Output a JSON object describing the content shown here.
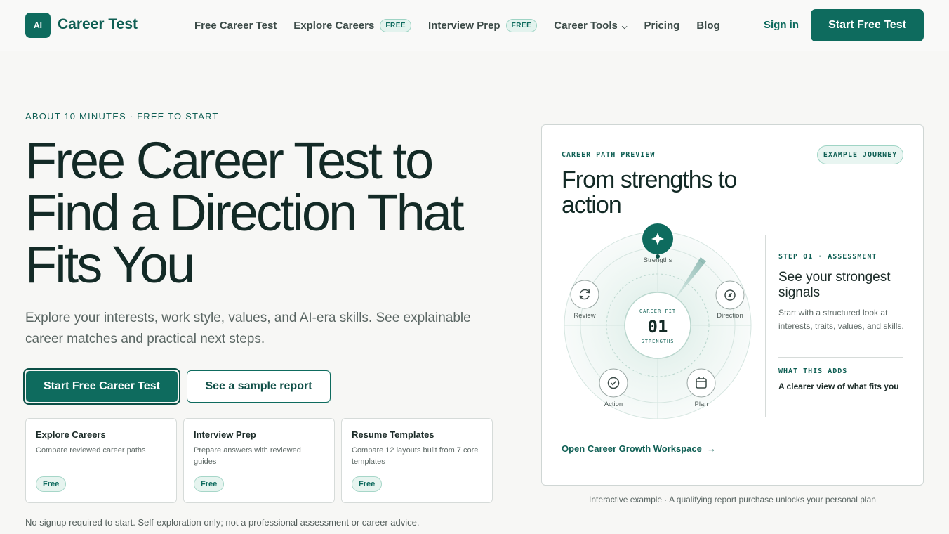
{
  "header": {
    "logo_badge": "AI",
    "logo_text": "Career Test",
    "nav": [
      {
        "label": "Free Career Test"
      },
      {
        "label": "Explore Careers",
        "badge": "FREE"
      },
      {
        "label": "Interview Prep",
        "badge": "FREE"
      },
      {
        "label": "Career Tools"
      },
      {
        "label": "Pricing"
      },
      {
        "label": "Blog"
      }
    ],
    "sign_in": "Sign in",
    "cta": "Start Free Test"
  },
  "hero": {
    "eyebrow": "ABOUT 10 MINUTES · FREE TO START",
    "title": "Free Career Test to Find a Direction That Fits You",
    "subtitle": "Explore your interests, work style, values, and AI-era skills. See explainable career matches and practical next steps.",
    "primary_cta": "Start Free Career Test",
    "secondary_cta": "See a sample report",
    "cards": [
      {
        "title": "Explore Careers",
        "desc": "Compare reviewed career paths",
        "badge": "Free"
      },
      {
        "title": "Interview Prep",
        "desc": "Prepare answers with reviewed guides",
        "badge": "Free"
      },
      {
        "title": "Resume Templates",
        "desc": "Compare 12 layouts built from 7 core templates",
        "badge": "Free"
      }
    ],
    "disclaimer": "No signup required to start. Self-exploration only; not a professional assessment or career advice."
  },
  "preview": {
    "eyebrow": "CAREER PATH PREVIEW",
    "pill": "EXAMPLE JOURNEY",
    "title": "From strengths to action",
    "wheel": {
      "center_top": "CAREER FIT",
      "center_number": "01",
      "center_bottom": "STRENGTHS",
      "nodes": [
        {
          "label": "Strengths",
          "icon": "sparkle-icon"
        },
        {
          "label": "Direction",
          "icon": "compass-icon"
        },
        {
          "label": "Plan",
          "icon": "calendar-icon"
        },
        {
          "label": "Action",
          "icon": "check-circle-icon"
        },
        {
          "label": "Review",
          "icon": "refresh-icon"
        }
      ]
    },
    "step_eyebrow": "STEP 01 · ASSESSMENT",
    "step_title": "See your strongest signals",
    "step_desc": "Start with a structured look at interests, traits, values, and skills.",
    "adds_eyebrow": "WHAT THIS ADDS",
    "adds_text": "A clearer view of what fits you",
    "link": "Open Career Growth Workspace",
    "link_arrow": "→",
    "caption": "Interactive example · A qualifying report purchase unlocks your personal plan"
  },
  "colors": {
    "brand": "#0e6b5e",
    "background": "#f7f7f5"
  }
}
